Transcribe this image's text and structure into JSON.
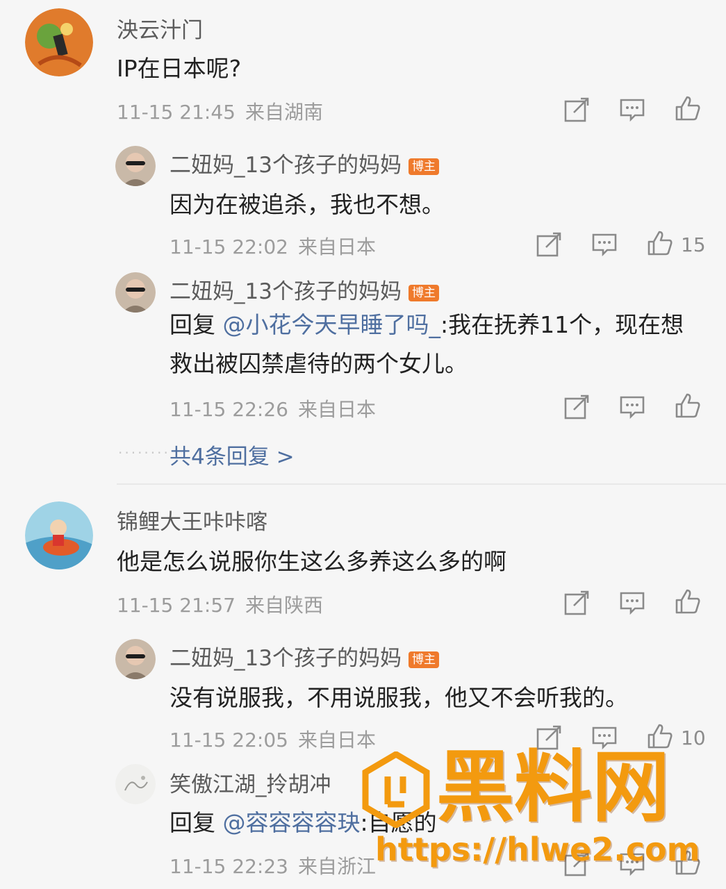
{
  "comments": [
    {
      "user": "泱云汁门",
      "text": "IP在日本呢?",
      "time": "11-15 21:45",
      "location": "来自湖南",
      "replies": [
        {
          "user": "二妞妈_13个孩子的妈妈",
          "badge": "博主",
          "text": "因为在被追杀，我也不想。",
          "time": "11-15 22:02",
          "location": "来自日本",
          "likes": "15"
        },
        {
          "user": "二妞妈_13个孩子的妈妈",
          "badge": "博主",
          "prefix": "回复 ",
          "mention": "@小花今天早睡了吗_",
          "text": ":我在抚养11个，现在想救出被囚禁虐待的两个女儿。",
          "time": "11-15 22:26",
          "location": "来自日本"
        }
      ],
      "more_replies": "共4条回复 >"
    },
    {
      "user": "锦鲤大王咔咔喀",
      "text": "他是怎么说服你生这么多养这么多的啊",
      "time": "11-15 21:57",
      "location": "来自陕西",
      "replies": [
        {
          "user": "二妞妈_13个孩子的妈妈",
          "badge": "博主",
          "text": "没有说服我，不用说服我，他又不会听我的。",
          "time": "11-15 22:05",
          "location": "来自日本",
          "likes": "10"
        },
        {
          "user": "笑傲江湖_拎胡冲",
          "prefix": "回复 ",
          "mention": "@容容容容玦",
          "text": ":自愿的",
          "time": "11-15 22:23",
          "location": "来自浙江"
        }
      ]
    }
  ],
  "watermark": {
    "brand": "黑料网",
    "url": "https://hlwe2.com"
  },
  "icons": {
    "share": "share-icon",
    "comment": "comment-icon",
    "like": "thumbs-up-icon"
  },
  "colors": {
    "link": "#4f6fa0",
    "badge": "#ef7a2c",
    "watermark": "#f39a0f"
  }
}
